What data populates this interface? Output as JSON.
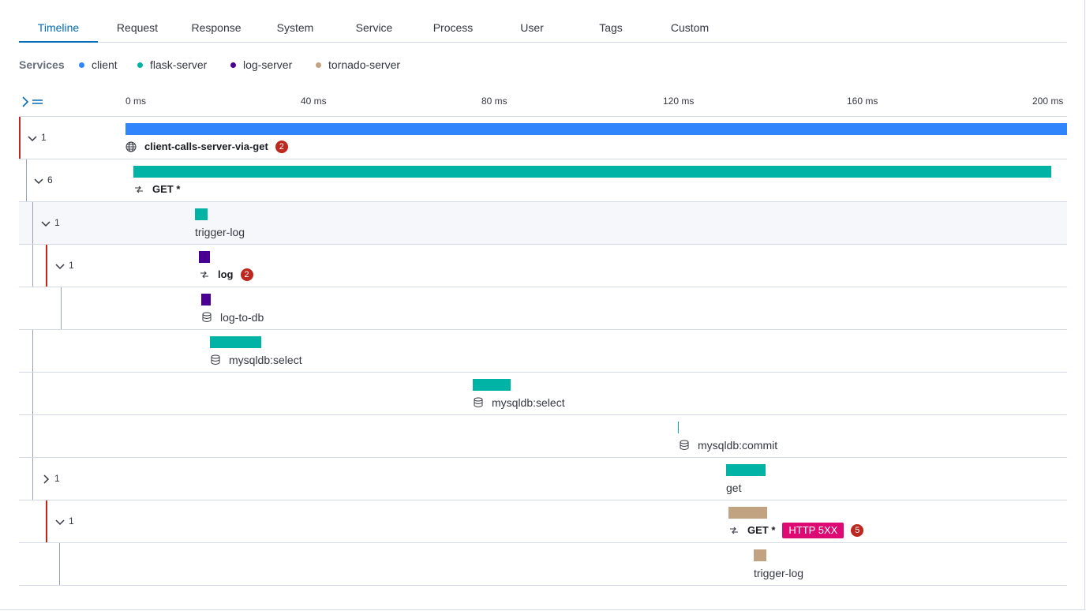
{
  "tabs": [
    {
      "label": "Timeline",
      "active": true
    },
    {
      "label": "Request"
    },
    {
      "label": "Response"
    },
    {
      "label": "System"
    },
    {
      "label": "Service"
    },
    {
      "label": "Process"
    },
    {
      "label": "User"
    },
    {
      "label": "Tags"
    },
    {
      "label": "Custom"
    }
  ],
  "legend": {
    "title": "Services",
    "items": [
      {
        "label": "client",
        "color": "#3185fc"
      },
      {
        "label": "flask-server",
        "color": "#00b3a4"
      },
      {
        "label": "log-server",
        "color": "#490092"
      },
      {
        "label": "tornado-server",
        "color": "#c1a382"
      }
    ]
  },
  "axis": {
    "ticks": [
      "0 ms",
      "40 ms",
      "80 ms",
      "120 ms",
      "160 ms",
      "200 ms"
    ]
  },
  "spans": [
    {
      "count": "1",
      "name": "client-calls-server-via-get",
      "icon": "globe-icon",
      "errors": "2",
      "service": "client"
    },
    {
      "count": "6",
      "name": "GET *",
      "icon": "transaction-icon",
      "service": "flask-server"
    },
    {
      "count": "1",
      "name": "trigger-log",
      "service": "flask-server"
    },
    {
      "count": "1",
      "name": "log",
      "icon": "transaction-icon",
      "errors": "2",
      "service": "log-server"
    },
    {
      "name": "log-to-db",
      "icon": "database-icon",
      "service": "log-server"
    },
    {
      "name": "mysqldb:select",
      "icon": "database-icon",
      "service": "flask-server"
    },
    {
      "name": "mysqldb:select",
      "icon": "database-icon",
      "service": "flask-server"
    },
    {
      "name": "mysqldb:commit",
      "icon": "database-icon",
      "service": "flask-server"
    },
    {
      "count": "1",
      "name": "get",
      "service": "flask-server"
    },
    {
      "count": "1",
      "name": "GET *",
      "icon": "transaction-icon",
      "http": "HTTP 5XX",
      "errors": "5",
      "service": "tornado-server"
    },
    {
      "name": "trigger-log",
      "service": "tornado-server"
    }
  ]
}
